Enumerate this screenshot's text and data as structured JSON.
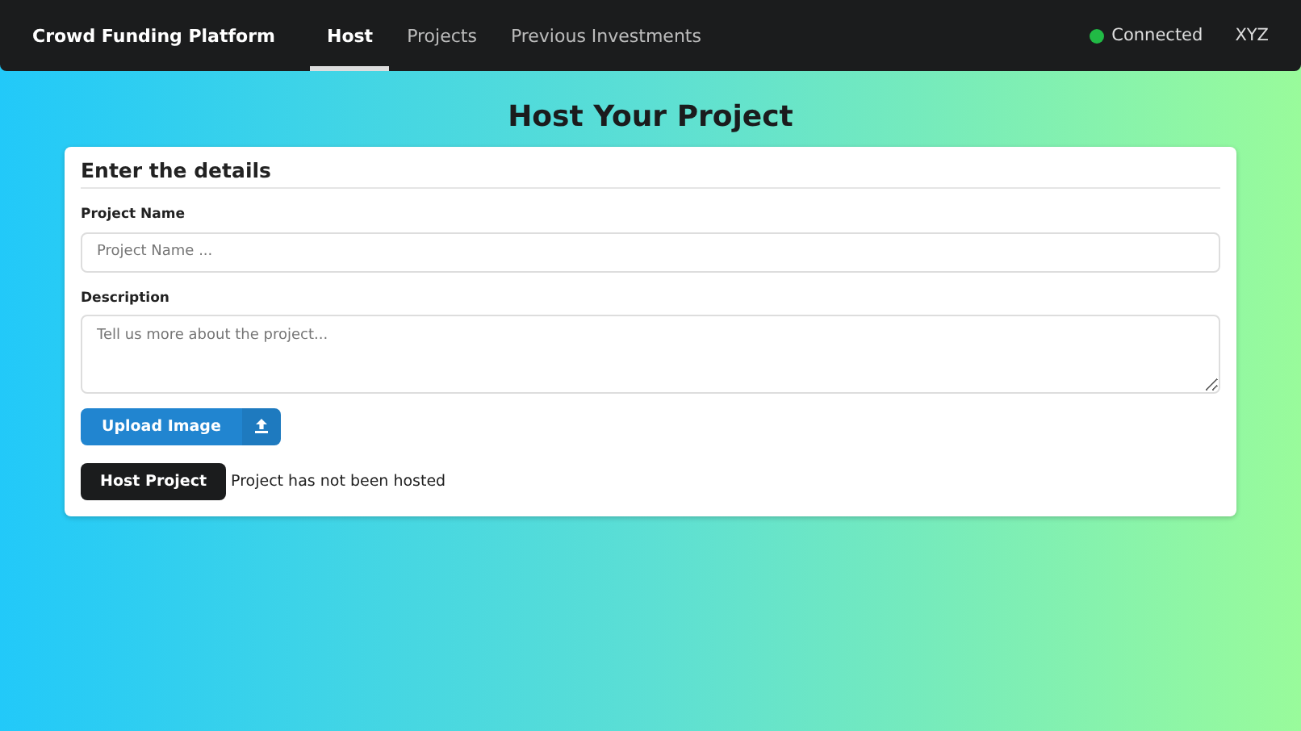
{
  "navbar": {
    "brand": "Crowd Funding Platform",
    "tabs": [
      {
        "label": "Host",
        "selected": true
      },
      {
        "label": "Projects",
        "selected": false
      },
      {
        "label": "Previous Investments",
        "selected": false
      }
    ],
    "status": {
      "label": "Connected",
      "connected": true
    },
    "account": "XYZ"
  },
  "page_title": "Host Your Project",
  "form": {
    "heading": "Enter the details",
    "fields": [
      {
        "kind": "input",
        "label": "Project Name",
        "placeholder": "Project Name ..."
      },
      {
        "kind": "textarea",
        "label": "Description",
        "placeholder": "Tell us more about the project..."
      }
    ],
    "upload_button": "Upload Image",
    "submit_button": "Host Project",
    "status_message": "Project has not been hosted"
  }
}
